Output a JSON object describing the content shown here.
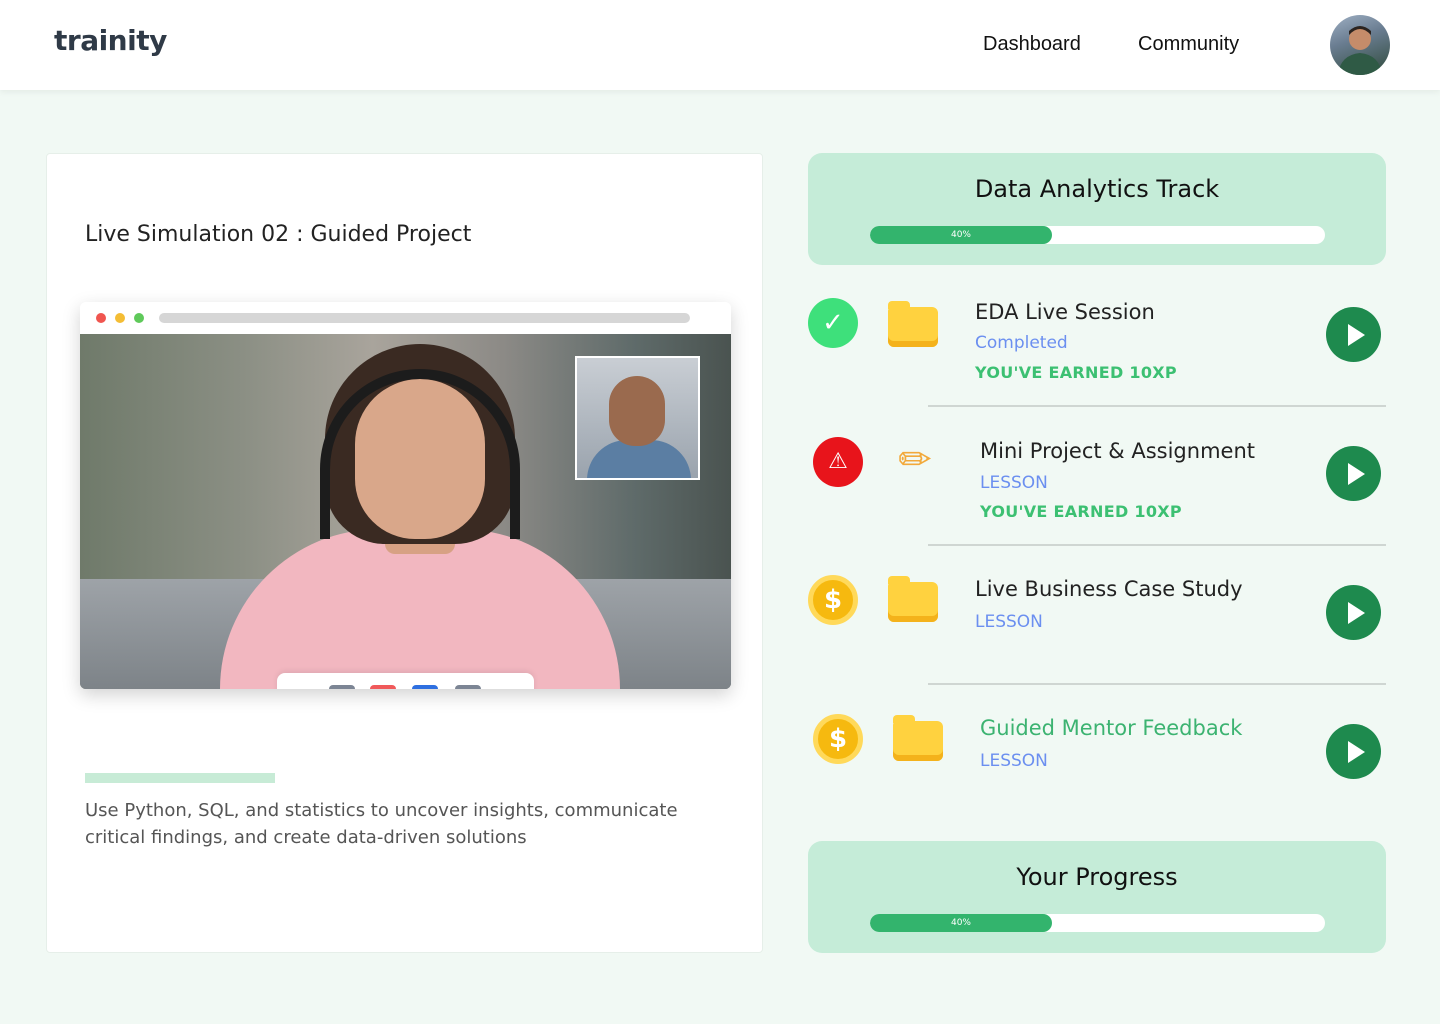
{
  "header": {
    "logo": "trainity",
    "nav": [
      "Dashboard",
      "Community"
    ]
  },
  "simulation": {
    "title": "Live Simulation 02 : Guided Project",
    "description": "Use Python, SQL, and statistics to uncover insights, communicate critical findings, and create data-driven solutions"
  },
  "track": {
    "title": "Data Analytics Track",
    "progress_label": "40%",
    "progress_value": 0.4
  },
  "lessons": [
    {
      "title": "EDA Live Session",
      "status": "Completed",
      "xp": "YOU'VE EARNED 10XP",
      "status_icon": "check-icon",
      "type_icon": "folder-icon"
    },
    {
      "title": "Mini Project & Assignment",
      "status": "LESSON",
      "xp": "YOU'VE EARNED 10XP",
      "status_icon": "alert-icon",
      "type_icon": "pencil-icon"
    },
    {
      "title": "Live Business Case Study",
      "status": "LESSON",
      "status_icon": "coin-icon",
      "type_icon": "folder-icon"
    },
    {
      "title": "Guided Mentor Feedback",
      "status": "LESSON",
      "status_icon": "coin-icon",
      "type_icon": "folder-icon"
    }
  ],
  "progress": {
    "title": "Your Progress",
    "progress_label": "40%",
    "progress_value": 0.4
  },
  "colors": {
    "brand_green": "#33b46d",
    "card_mint": "#c5ecd8",
    "play_green": "#1e8a4e",
    "link_blue": "#6b8ff0"
  }
}
